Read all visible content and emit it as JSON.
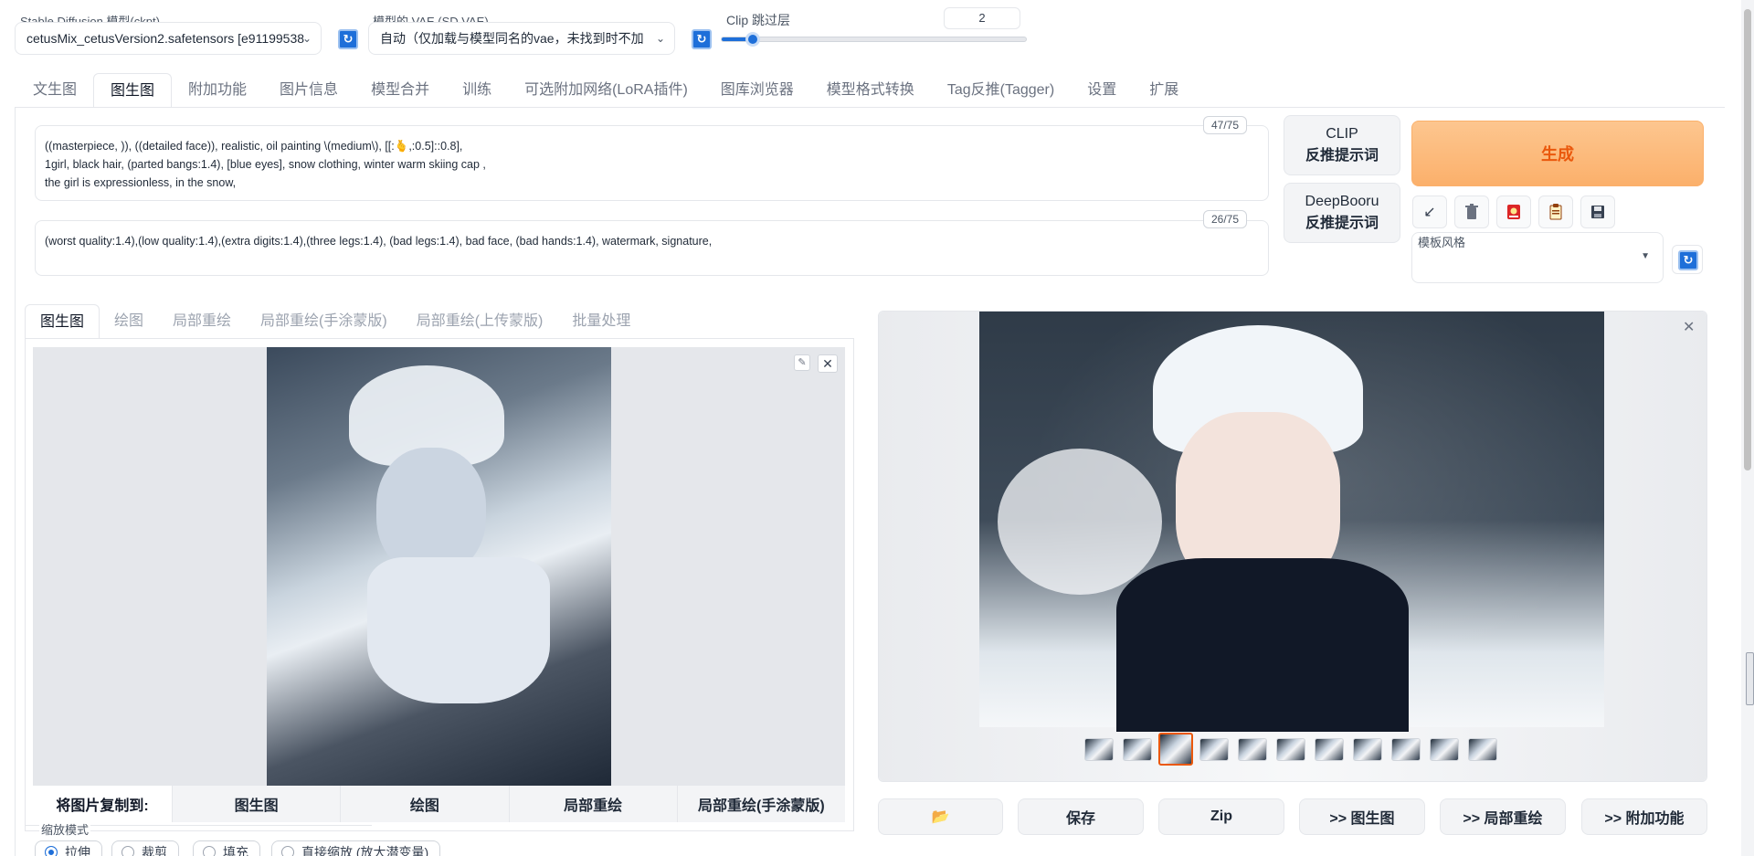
{
  "top": {
    "ckpt_label": "Stable Diffusion 模型(ckpt)",
    "ckpt_value": "cetusMix_cetusVersion2.safetensors [e91199538",
    "vae_label": "模型的 VAE (SD VAE)",
    "vae_value": "自动（仅加载与模型同名的vae，未找到时不加",
    "clip_label": "Clip 跳过层",
    "clip_value": "2",
    "clip_fraction": 0.1
  },
  "tabs": [
    "文生图",
    "图生图",
    "附加功能",
    "图片信息",
    "模型合并",
    "训练",
    "可选附加网络(LoRA插件)",
    "图库浏览器",
    "模型格式转换",
    "Tag反推(Tagger)",
    "设置",
    "扩展"
  ],
  "prompt": {
    "positive": "((masterpiece, )), ((detailed face)), realistic, oil painting \\(medium\\), [[:🫰,:0.5]::0.8],\n1girl, black hair, (parted bangs:1.4), [blue eyes], snow clothing, winter warm skiing cap ,\nthe girl is expressionless, in the snow,",
    "positive_count": "47/75",
    "negative": "(worst quality:1.4),(low quality:1.4),(extra digits:1.4),(three legs:1.4), (bad legs:1.4), bad face, (bad hands:1.4), watermark, signature,",
    "negative_count": "26/75"
  },
  "buttons": {
    "clip_interrogate_line1": "CLIP",
    "clip_interrogate_line2": "反推提示词",
    "deepbooru_line1": "DeepBooru",
    "deepbooru_line2": "反推提示词",
    "generate": "生成",
    "style_label": "模板风格"
  },
  "tools": [
    "arrow-icon",
    "trash-icon",
    "card-icon",
    "clipboard-icon",
    "save-icon"
  ],
  "subtabs": [
    "图生图",
    "绘图",
    "局部重绘",
    "局部重绘(手涂蒙版)",
    "局部重绘(上传蒙版)",
    "批量处理"
  ],
  "copy_to": {
    "label": "将图片复制到:",
    "targets": [
      "图生图",
      "绘图",
      "局部重绘",
      "局部重绘(手涂蒙版)"
    ]
  },
  "resize": {
    "label": "缩放模式",
    "options": [
      "拉伸",
      "裁剪",
      "填充",
      "直接缩放 (放大潜变量)"
    ]
  },
  "output_buttons": [
    "📂",
    "保存",
    "Zip",
    ">> 图生图",
    ">> 局部重绘",
    ">> 附加功能"
  ]
}
